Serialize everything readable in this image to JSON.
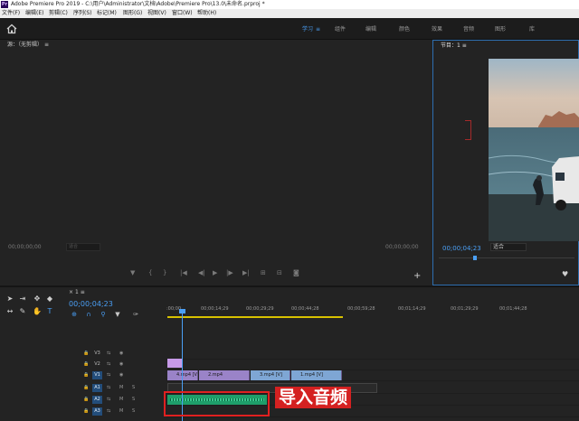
{
  "window": {
    "title": "Adobe Premiere Pro 2019 - C:\\用户\\Administrator\\文档\\Adobe\\Premiere Pro\\13.0\\未命名.prproj *",
    "app_icon": "Pr"
  },
  "menu": [
    "文件(F)",
    "编辑(E)",
    "剪辑(C)",
    "序列(S)",
    "标记(M)",
    "图形(G)",
    "视图(V)",
    "窗口(W)",
    "帮助(H)"
  ],
  "workspaces": {
    "tabs": [
      "学习",
      "组件",
      "编辑",
      "颜色",
      "效果",
      "音频",
      "图形",
      "库"
    ],
    "active": "学习",
    "menu_icon": "≡"
  },
  "source_panel": {
    "title": "源：（无剪辑）",
    "timecode_in": "00;00;00;00",
    "fit_label": "适合",
    "timecode_out": "00;00;00;00"
  },
  "program_panel": {
    "title": "节目：1",
    "timecode": "00;00;04;23",
    "fit_label": "适合"
  },
  "timeline": {
    "sequence_name": "1",
    "timecode": "00;00;04;23",
    "ruler_labels": [
      ":00;00",
      "00;00;14;29",
      "00;00;29;29",
      "00;00;44;28",
      "00;00;59;28",
      "00;01;14;29",
      "00;01;29;29",
      "00;01;44;28"
    ],
    "video_tracks": [
      "V3",
      "V2",
      "V1"
    ],
    "audio_tracks": [
      "A1",
      "A2",
      "A3"
    ],
    "track_toggles": {
      "mute": "M",
      "solo": "S"
    },
    "video_clips": [
      "4.mp4 [V]",
      "2.mp4",
      "3.mp4 [V]",
      "1.mp4 [V]"
    ],
    "callout_text": "导入音频"
  },
  "icons": {
    "home": "home-icon",
    "selection": "selection-tool-icon",
    "track_select": "track-select-icon",
    "ripple": "ripple-edit-icon",
    "razor": "razor-icon",
    "slip": "slip-icon",
    "pen": "pen-icon",
    "hand": "hand-icon",
    "type": "type-icon"
  },
  "colors": {
    "accent": "#4a9ff5",
    "video_clip": "#9a83c8",
    "audio_clip": "#1e9e6a",
    "highlight": "#d42121"
  }
}
